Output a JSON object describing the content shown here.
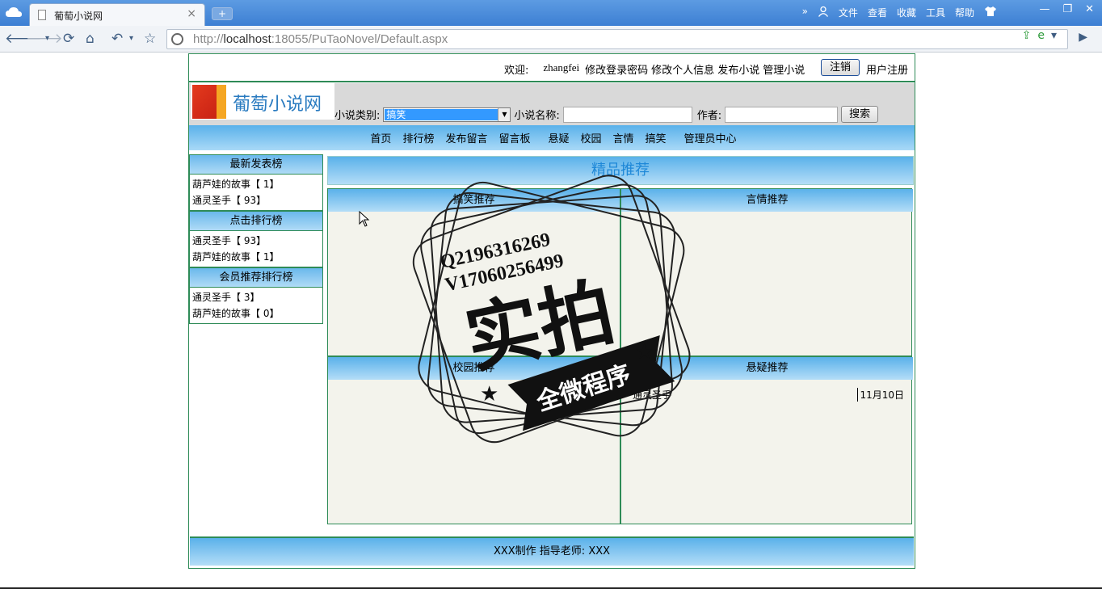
{
  "browser": {
    "tab_title": "葡萄小说网",
    "tab_close": "×",
    "new_tab": "+",
    "menu": [
      "»",
      "文件",
      "查看",
      "收藏",
      "工具",
      "帮助"
    ],
    "window_buttons": [
      "—",
      "❐",
      "✕"
    ],
    "url_prefix": "http://",
    "url_host": "localhost",
    "url_rest": ":18055/PuTaoNovel/Default.aspx"
  },
  "topbar": {
    "welcome": "欢迎:",
    "username": "zhangfei",
    "links": [
      "修改登录密码",
      "修改个人信息",
      "发布小说",
      "管理小说"
    ],
    "logout": "注销",
    "register": "用户注册"
  },
  "header": {
    "logo_text": "葡萄小说网",
    "category_label": "小说类别:",
    "category_value": "搞笑",
    "name_label": "小说名称:",
    "author_label": "作者:",
    "search_button": "搜索"
  },
  "nav": [
    "首页",
    "排行榜",
    "发布留言",
    "留言板",
    "悬疑",
    "校园",
    "言情",
    "搞笑",
    "管理员中心"
  ],
  "sidebar": {
    "sections": [
      {
        "title": "最新发表榜",
        "items": [
          "葫芦娃的故事【 1】",
          "通灵圣手【 93】"
        ]
      },
      {
        "title": "点击排行榜",
        "items": [
          "通灵圣手【 93】",
          "葫芦娃的故事【 1】"
        ]
      },
      {
        "title": "会员推荐排行榜",
        "items": [
          "通灵圣手【 3】",
          "葫芦娃的故事【 0】"
        ]
      }
    ]
  },
  "main": {
    "title": "精品推荐",
    "cells": [
      {
        "title": "搞笑推荐",
        "rows": []
      },
      {
        "title": "言情推荐",
        "rows": []
      },
      {
        "title": "校园推荐",
        "rows": []
      },
      {
        "title": "悬疑推荐",
        "rows": [
          {
            "title": "通灵圣手",
            "date": "11月10日"
          }
        ]
      }
    ]
  },
  "watermark": {
    "line1": "Q2196316269",
    "line2": "V17060256499",
    "big": "实拍",
    "banner": "全微程序"
  },
  "footer": {
    "text": "XXX制作  指导老师: XXX"
  }
}
